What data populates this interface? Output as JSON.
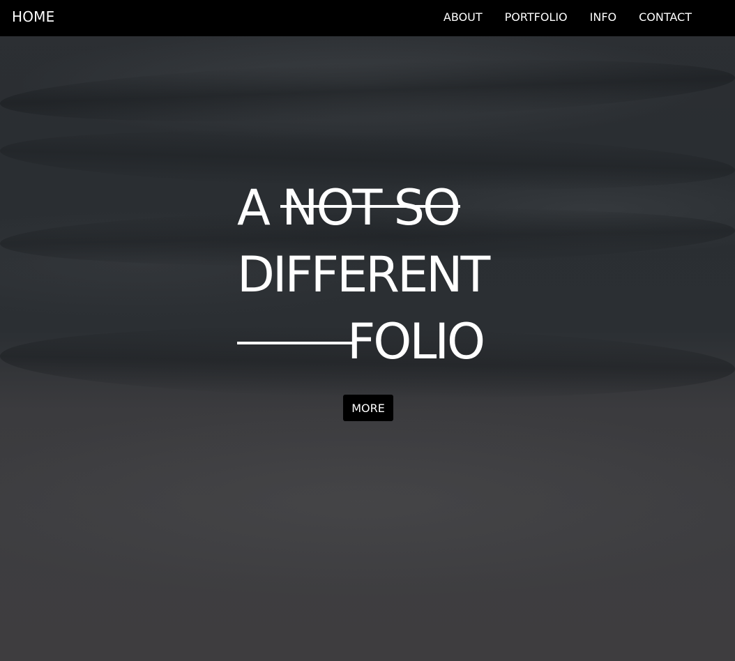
{
  "nav": {
    "home_label": "HOME",
    "links": [
      {
        "label": "ABOUT"
      },
      {
        "label": "PORTFOLIO"
      },
      {
        "label": "INFO"
      },
      {
        "label": "CONTACT"
      }
    ]
  },
  "hero": {
    "line1_prefix": "A",
    "line1_struck": "NOT SO",
    "line2": "DIFFERENT",
    "line3": "FOLIO",
    "more_label": "MORE"
  },
  "colors": {
    "nav_bg": "#000000",
    "text": "#ffffff",
    "button_bg": "#000000"
  }
}
